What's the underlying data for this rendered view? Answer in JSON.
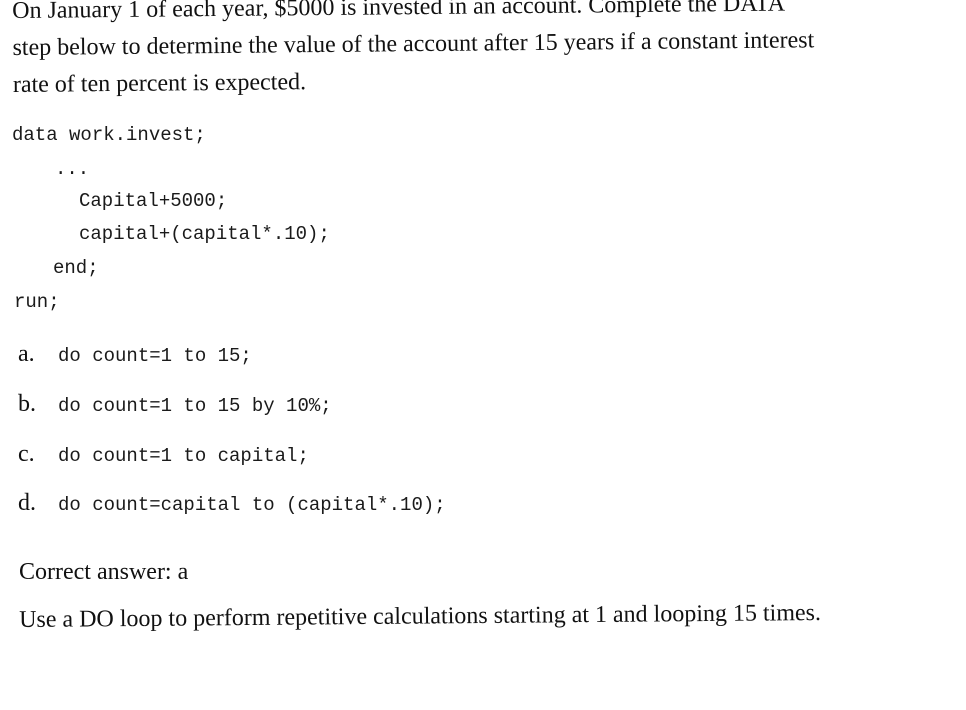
{
  "question": {
    "lines": [
      "On January 1 of each year, $5000 is invested in an account. Complete the DATA",
      "step below to determine the value of the account after 15 years if a constant interest",
      "rate of ten percent is expected."
    ]
  },
  "code": {
    "lines": [
      "data work.invest;",
      "...",
      "Capital+5000;",
      "capital+(capital*.10);",
      "end;",
      "run;"
    ]
  },
  "options": [
    {
      "letter": "a.",
      "code": "do count=1 to 15;"
    },
    {
      "letter": "b.",
      "code": "do count=1 to 15 by 10%;"
    },
    {
      "letter": "c.",
      "code": "do count=1 to capital;"
    },
    {
      "letter": "d.",
      "code": "do count=capital to (capital*.10);"
    }
  ],
  "answer": {
    "text": "Correct answer: a"
  },
  "explanation": {
    "text": "Use a DO loop to perform repetitive calculations starting at 1 and looping 15 times."
  }
}
